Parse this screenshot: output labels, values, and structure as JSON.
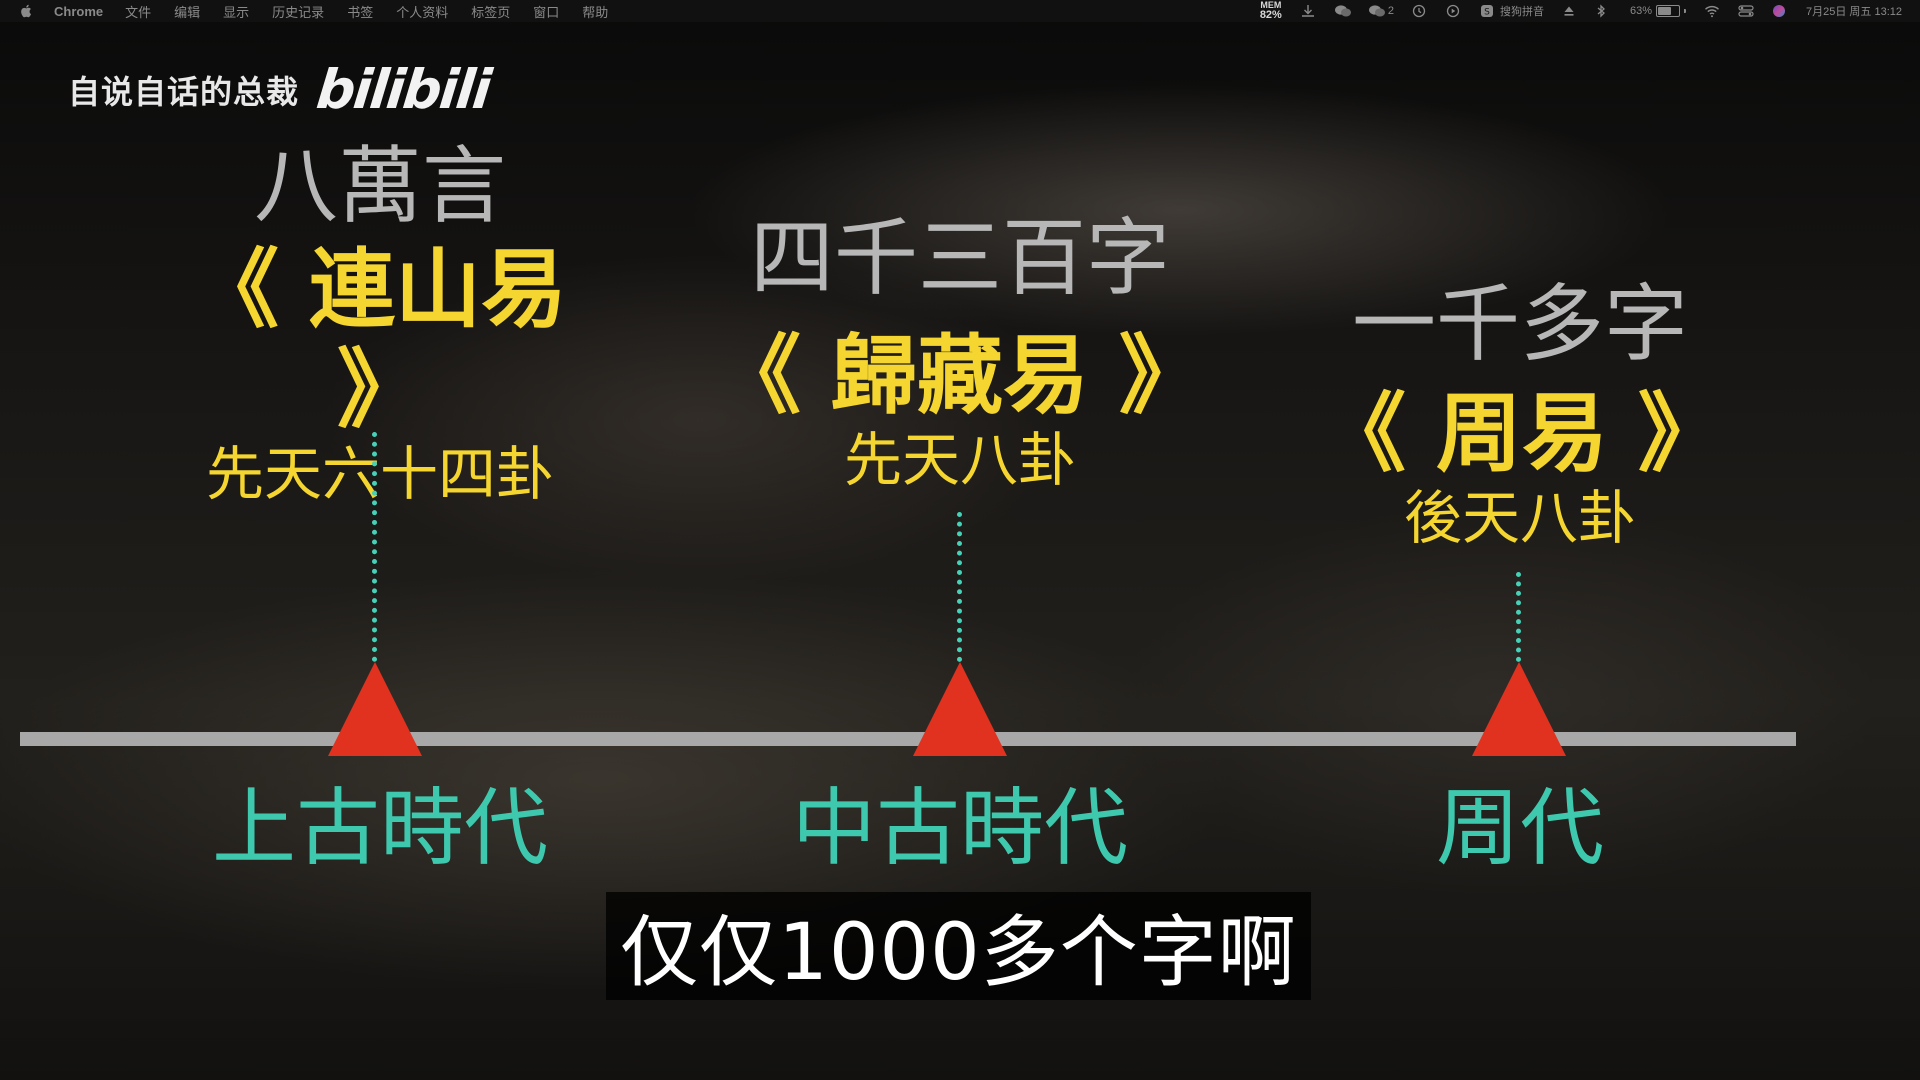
{
  "menubar": {
    "apple": "",
    "app": "Chrome",
    "menus": [
      "文件",
      "编辑",
      "显示",
      "历史记录",
      "书签",
      "个人资料",
      "标签页",
      "窗口",
      "帮助"
    ],
    "mem_label": "MEM",
    "mem_value": "82%",
    "wechat_count": "2",
    "input_method": "搜狗拼音",
    "battery": "63%",
    "battery_level": 0.63,
    "datetime": "7月25日 周五 13:12"
  },
  "watermark": {
    "channel": "自说自话的总裁",
    "logo": "bilibili"
  },
  "groups": [
    {
      "count": "八萬言",
      "book": "《 連山易 》",
      "desc": "先天六十四卦",
      "era": "上古時代"
    },
    {
      "count": "四千三百字",
      "book": "《 歸藏易 》",
      "desc": "先天八卦",
      "era": "中古時代"
    },
    {
      "count": "一千多字",
      "book": "《 周易 》",
      "desc": "後天八卦",
      "era": "周代"
    }
  ],
  "subtitle": "仅仅1000多个字啊",
  "colors": {
    "book": "#f5d630",
    "era": "#3ec9ae",
    "marker": "#e0321e",
    "timeline": "#a8a8a8",
    "count": "#b7b7b7"
  }
}
